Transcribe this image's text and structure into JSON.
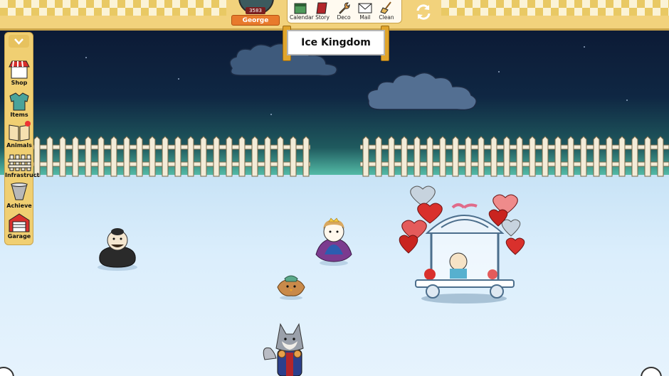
{
  "player": {
    "coins": "3583",
    "name": "George"
  },
  "toolbar": {
    "items": [
      {
        "label": "Calendar",
        "icon": "calendar-icon"
      },
      {
        "label": "Story",
        "icon": "book-icon"
      },
      {
        "label": "Deco",
        "icon": "wrench-icon"
      },
      {
        "label": "Mail",
        "icon": "mail-icon"
      },
      {
        "label": "Clean",
        "icon": "broom-icon"
      }
    ],
    "refresh_icon": "refresh-icon"
  },
  "location": {
    "title": "Ice Kingdom"
  },
  "sidebar": {
    "toggle_icon": "chevron-down-icon",
    "items": [
      {
        "label": "Shop",
        "icon": "shop-icon"
      },
      {
        "label": "Items",
        "icon": "items-icon"
      },
      {
        "label": "Animals",
        "icon": "animals-book-icon",
        "notification": true
      },
      {
        "label": "Infrastruct",
        "icon": "fence-icon"
      },
      {
        "label": "Achieve",
        "icon": "trophy-cup-icon"
      },
      {
        "label": "Garage",
        "icon": "garage-icon"
      }
    ]
  },
  "colors": {
    "topbar": "#f2d27c",
    "name_tag": "#e87a2c",
    "sky_top": "#0c1a35",
    "horizon": "#5fd1b7",
    "ice": "#dbeefc",
    "fence": "#f3ecd8"
  },
  "characters": [
    {
      "name": "bear-in-black",
      "icon": "bear-character"
    },
    {
      "name": "princess-bear",
      "icon": "princess-character"
    },
    {
      "name": "small-bird",
      "icon": "bird-character"
    },
    {
      "name": "wolf-knight",
      "icon": "wolf-character"
    },
    {
      "name": "heart-carriage",
      "icon": "carriage-icon"
    }
  ]
}
